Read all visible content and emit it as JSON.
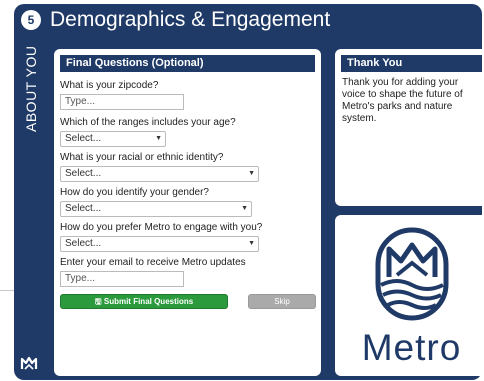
{
  "header": {
    "step_number": "5",
    "title": "Demographics & Engagement"
  },
  "sidebar": {
    "label": "ABOUT YOU"
  },
  "colors": {
    "navy": "#1f3a67",
    "submit_green": "#2a9a3c",
    "skip_gray": "#aaaaaa"
  },
  "form": {
    "heading": "Final Questions (Optional)",
    "zipcode": {
      "label": "What is your zipcode?",
      "placeholder": "Type..."
    },
    "age": {
      "label": "Which of the ranges includes your age?",
      "value": "Select..."
    },
    "race": {
      "label": "What is your racial or ethnic identity?",
      "value": "Select..."
    },
    "gender": {
      "label": "How do you identify your gender?",
      "value": "Select..."
    },
    "engage": {
      "label": "How do you prefer Metro to engage with you?",
      "value": "Select..."
    },
    "email": {
      "label": "Enter your email to receive Metro updates",
      "placeholder": "Type..."
    },
    "submit_label": "Submit Final Questions",
    "skip_label": "Skip"
  },
  "thanks": {
    "heading": "Thank You",
    "body": "Thank you for adding your voice to shape the future of Metro's parks and nature system."
  },
  "logo": {
    "wordmark": "Metro",
    "icon": "metro-logo-icon"
  }
}
